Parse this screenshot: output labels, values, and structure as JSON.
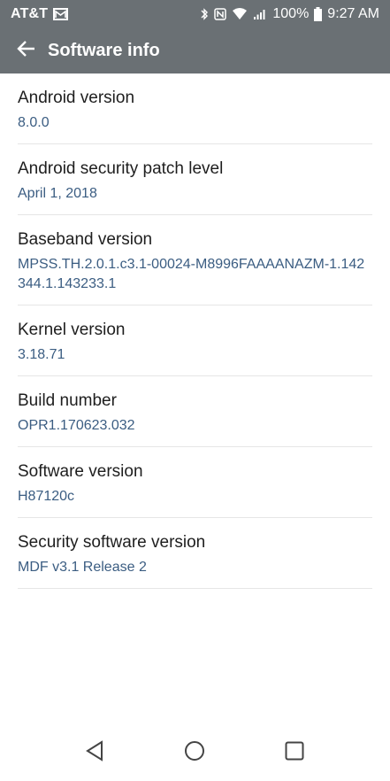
{
  "status_bar": {
    "carrier": "AT&T",
    "battery": "100%",
    "time": "9:27 AM"
  },
  "header": {
    "title": "Software info"
  },
  "items": [
    {
      "label": "Android version",
      "value": "8.0.0"
    },
    {
      "label": "Android security patch level",
      "value": "April 1, 2018"
    },
    {
      "label": "Baseband version",
      "value": "MPSS.TH.2.0.1.c3.1-00024-M8996FAAAANAZM-1.142344.1.143233.1"
    },
    {
      "label": "Kernel version",
      "value": "3.18.71"
    },
    {
      "label": "Build number",
      "value": "OPR1.170623.032"
    },
    {
      "label": "Software version",
      "value": "H87120c"
    },
    {
      "label": "Security software version",
      "value": "MDF v3.1 Release 2"
    }
  ],
  "colors": {
    "bar_background": "#6a7074",
    "value_text": "#3b5d82",
    "label_text": "#1e1e1e"
  },
  "icons": [
    "message-icon",
    "bluetooth-icon",
    "nfc-icon",
    "wifi-icon",
    "signal-icon",
    "battery-icon",
    "back-arrow-icon",
    "nav-back-icon",
    "nav-home-icon",
    "nav-recents-icon"
  ]
}
